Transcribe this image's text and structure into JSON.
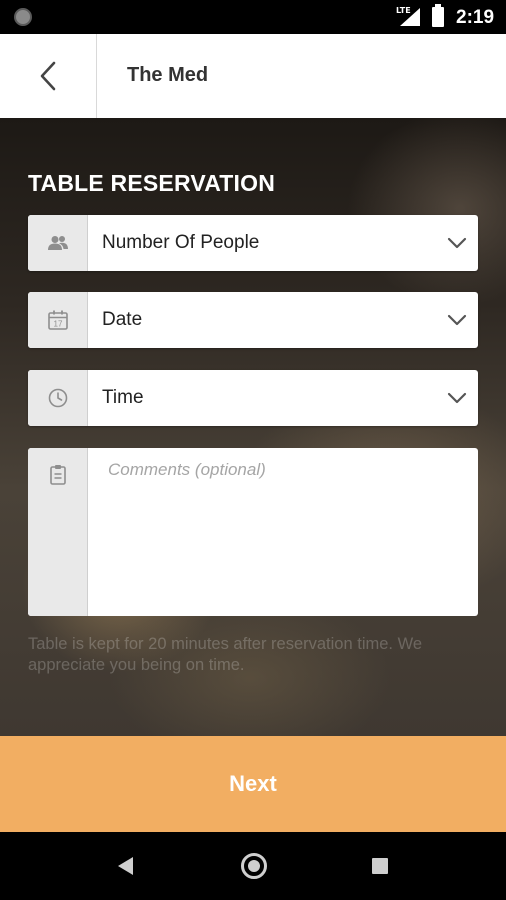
{
  "status_bar": {
    "time": "2:19",
    "network": "LTE",
    "icons": [
      "notification-dot-icon",
      "signal-icon",
      "battery-icon"
    ]
  },
  "app_bar": {
    "title": "The Med",
    "back_icon": "chevron-left-icon"
  },
  "form": {
    "section_title": "TABLE RESERVATION",
    "fields": [
      {
        "label": "Number Of People",
        "icon": "people-icon"
      },
      {
        "label": "Date",
        "icon": "calendar-icon"
      },
      {
        "label": "Time",
        "icon": "clock-icon"
      }
    ],
    "comments": {
      "placeholder": "Comments (optional)",
      "value": "",
      "icon": "clipboard-icon"
    },
    "note": "Table is kept for 20 minutes after reservation time. We appreciate you being on time."
  },
  "next_button": {
    "label": "Next"
  },
  "colors": {
    "accent": "#f2ae62",
    "field_icon_bg": "#e9e9e9",
    "app_bar_bg": "#ffffff"
  },
  "nav_bar": {
    "icons": [
      "nav-back-icon",
      "nav-home-icon",
      "nav-recents-icon"
    ]
  }
}
